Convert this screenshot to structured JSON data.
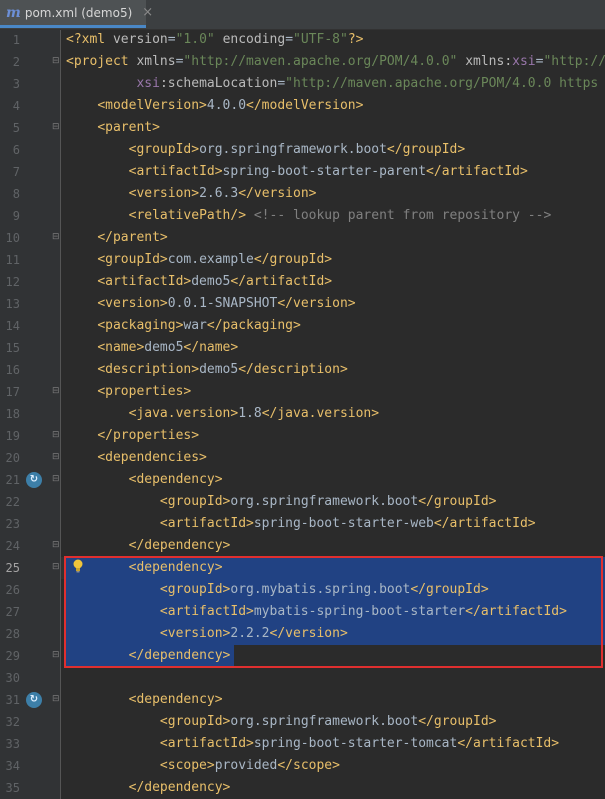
{
  "tab": {
    "icon": "m",
    "label": "pom.xml (demo5)",
    "close": "×"
  },
  "lines": [
    {
      "n": "1",
      "t": [
        [
          "t",
          "<?xml "
        ],
        [
          "a",
          "version"
        ],
        [
          "x",
          "="
        ],
        [
          "s",
          "\"1.0\""
        ],
        [
          "x",
          " "
        ],
        [
          "a",
          "encoding"
        ],
        [
          "x",
          "="
        ],
        [
          "s",
          "\"UTF-8\""
        ],
        [
          "t",
          "?>"
        ]
      ]
    },
    {
      "n": "2",
      "t": [
        [
          "t",
          "<project "
        ],
        [
          "a",
          "xmlns"
        ],
        [
          "x",
          "="
        ],
        [
          "s",
          "\"http://maven.apache.org/POM/4.0.0\""
        ],
        [
          "x",
          " "
        ],
        [
          "a",
          "xmlns:"
        ],
        [
          "ns",
          "xsi"
        ],
        [
          "x",
          "="
        ],
        [
          "s",
          "\"http://"
        ]
      ]
    },
    {
      "n": "3",
      "t": [
        [
          "x",
          "         "
        ],
        [
          "ns",
          "xsi"
        ],
        [
          "a",
          ":schemaLocation"
        ],
        [
          "x",
          "="
        ],
        [
          "s",
          "\"http://maven.apache.org/POM/4.0.0 https"
        ]
      ]
    },
    {
      "n": "4",
      "t": [
        [
          "x",
          "    "
        ],
        [
          "t",
          "<modelVersion>"
        ],
        [
          "x",
          "4.0.0"
        ],
        [
          "t",
          "</modelVersion>"
        ]
      ]
    },
    {
      "n": "5",
      "t": [
        [
          "x",
          "    "
        ],
        [
          "t",
          "<parent>"
        ]
      ]
    },
    {
      "n": "6",
      "t": [
        [
          "x",
          "        "
        ],
        [
          "t",
          "<groupId>"
        ],
        [
          "x",
          "org.springframework.boot"
        ],
        [
          "t",
          "</groupId>"
        ]
      ]
    },
    {
      "n": "7",
      "t": [
        [
          "x",
          "        "
        ],
        [
          "t",
          "<artifactId>"
        ],
        [
          "x",
          "spring-boot-starter-parent"
        ],
        [
          "t",
          "</artifactId>"
        ]
      ]
    },
    {
      "n": "8",
      "t": [
        [
          "x",
          "        "
        ],
        [
          "t",
          "<version>"
        ],
        [
          "x",
          "2.6.3"
        ],
        [
          "t",
          "</version>"
        ]
      ]
    },
    {
      "n": "9",
      "t": [
        [
          "x",
          "        "
        ],
        [
          "t",
          "<relativePath/>"
        ],
        [
          "x",
          " "
        ],
        [
          "c",
          "<!-- lookup parent from repository -->"
        ]
      ]
    },
    {
      "n": "10",
      "t": [
        [
          "x",
          "    "
        ],
        [
          "t",
          "</parent>"
        ]
      ]
    },
    {
      "n": "11",
      "t": [
        [
          "x",
          "    "
        ],
        [
          "t",
          "<groupId>"
        ],
        [
          "x",
          "com.example"
        ],
        [
          "t",
          "</groupId>"
        ]
      ]
    },
    {
      "n": "12",
      "t": [
        [
          "x",
          "    "
        ],
        [
          "t",
          "<artifactId>"
        ],
        [
          "x",
          "demo5"
        ],
        [
          "t",
          "</artifactId>"
        ]
      ]
    },
    {
      "n": "13",
      "t": [
        [
          "x",
          "    "
        ],
        [
          "t",
          "<version>"
        ],
        [
          "x",
          "0.0.1-SNAPSHOT"
        ],
        [
          "t",
          "</version>"
        ]
      ]
    },
    {
      "n": "14",
      "t": [
        [
          "x",
          "    "
        ],
        [
          "t",
          "<packaging>"
        ],
        [
          "x",
          "war"
        ],
        [
          "t",
          "</packaging>"
        ]
      ]
    },
    {
      "n": "15",
      "t": [
        [
          "x",
          "    "
        ],
        [
          "t",
          "<name>"
        ],
        [
          "x",
          "demo5"
        ],
        [
          "t",
          "</name>"
        ]
      ]
    },
    {
      "n": "16",
      "t": [
        [
          "x",
          "    "
        ],
        [
          "t",
          "<description>"
        ],
        [
          "x",
          "demo5"
        ],
        [
          "t",
          "</description>"
        ]
      ]
    },
    {
      "n": "17",
      "t": [
        [
          "x",
          "    "
        ],
        [
          "t",
          "<properties>"
        ]
      ]
    },
    {
      "n": "18",
      "t": [
        [
          "x",
          "        "
        ],
        [
          "t",
          "<java.version>"
        ],
        [
          "x",
          "1.8"
        ],
        [
          "t",
          "</java.version>"
        ]
      ]
    },
    {
      "n": "19",
      "t": [
        [
          "x",
          "    "
        ],
        [
          "t",
          "</properties>"
        ]
      ]
    },
    {
      "n": "20",
      "t": [
        [
          "x",
          "    "
        ],
        [
          "t",
          "<dependencies>"
        ]
      ]
    },
    {
      "n": "21",
      "t": [
        [
          "x",
          "        "
        ],
        [
          "t",
          "<dependency>"
        ]
      ]
    },
    {
      "n": "22",
      "t": [
        [
          "x",
          "            "
        ],
        [
          "t",
          "<groupId>"
        ],
        [
          "x",
          "org.springframework.boot"
        ],
        [
          "t",
          "</groupId>"
        ]
      ]
    },
    {
      "n": "23",
      "t": [
        [
          "x",
          "            "
        ],
        [
          "t",
          "<artifactId>"
        ],
        [
          "x",
          "spring-boot-starter-web"
        ],
        [
          "t",
          "</artifactId>"
        ]
      ]
    },
    {
      "n": "24",
      "t": [
        [
          "x",
          "        "
        ],
        [
          "t",
          "</dependency>"
        ]
      ]
    },
    {
      "n": "25",
      "t": [
        [
          "x",
          "        "
        ],
        [
          "t",
          "<dependency>"
        ]
      ]
    },
    {
      "n": "26",
      "t": [
        [
          "x",
          "            "
        ],
        [
          "t",
          "<groupId>"
        ],
        [
          "x",
          "org.mybatis.spring.boot"
        ],
        [
          "t",
          "</groupId>"
        ]
      ]
    },
    {
      "n": "27",
      "t": [
        [
          "x",
          "            "
        ],
        [
          "t",
          "<artifactId>"
        ],
        [
          "x",
          "mybatis-spring-boot-starter"
        ],
        [
          "t",
          "</artifactId>"
        ]
      ]
    },
    {
      "n": "28",
      "t": [
        [
          "x",
          "            "
        ],
        [
          "t",
          "<version>"
        ],
        [
          "x",
          "2.2.2"
        ],
        [
          "t",
          "</version>"
        ]
      ]
    },
    {
      "n": "29",
      "t": [
        [
          "x",
          "        "
        ],
        [
          "t",
          "</dependency>"
        ]
      ]
    },
    {
      "n": "30",
      "t": []
    },
    {
      "n": "31",
      "t": [
        [
          "x",
          "        "
        ],
        [
          "t",
          "<dependency>"
        ]
      ]
    },
    {
      "n": "32",
      "t": [
        [
          "x",
          "            "
        ],
        [
          "t",
          "<groupId>"
        ],
        [
          "x",
          "org.springframework.boot"
        ],
        [
          "t",
          "</groupId>"
        ]
      ]
    },
    {
      "n": "33",
      "t": [
        [
          "x",
          "            "
        ],
        [
          "t",
          "<artifactId>"
        ],
        [
          "x",
          "spring-boot-starter-tomcat"
        ],
        [
          "t",
          "</artifactId>"
        ]
      ]
    },
    {
      "n": "34",
      "t": [
        [
          "x",
          "            "
        ],
        [
          "t",
          "<scope>"
        ],
        [
          "x",
          "provided"
        ],
        [
          "t",
          "</scope>"
        ]
      ]
    },
    {
      "n": "35",
      "t": [
        [
          "x",
          "        "
        ],
        [
          "t",
          "</dependency>"
        ]
      ]
    }
  ],
  "current_line": "25",
  "fold_open_lines": [
    "2",
    "5",
    "17",
    "20",
    "21",
    "25",
    "31"
  ],
  "fold_close_lines": [
    "10",
    "19",
    "24",
    "29"
  ],
  "run_icon_lines": [
    "21",
    "31"
  ],
  "intention_bulb_line": "25",
  "colors": {
    "tag": "#e8bf6a",
    "attribute": "#bababa",
    "string": "#6a8759",
    "comment": "#808080",
    "text": "#a9b7c6",
    "selection": "#214283",
    "highlight_box": "#e02f2f"
  }
}
